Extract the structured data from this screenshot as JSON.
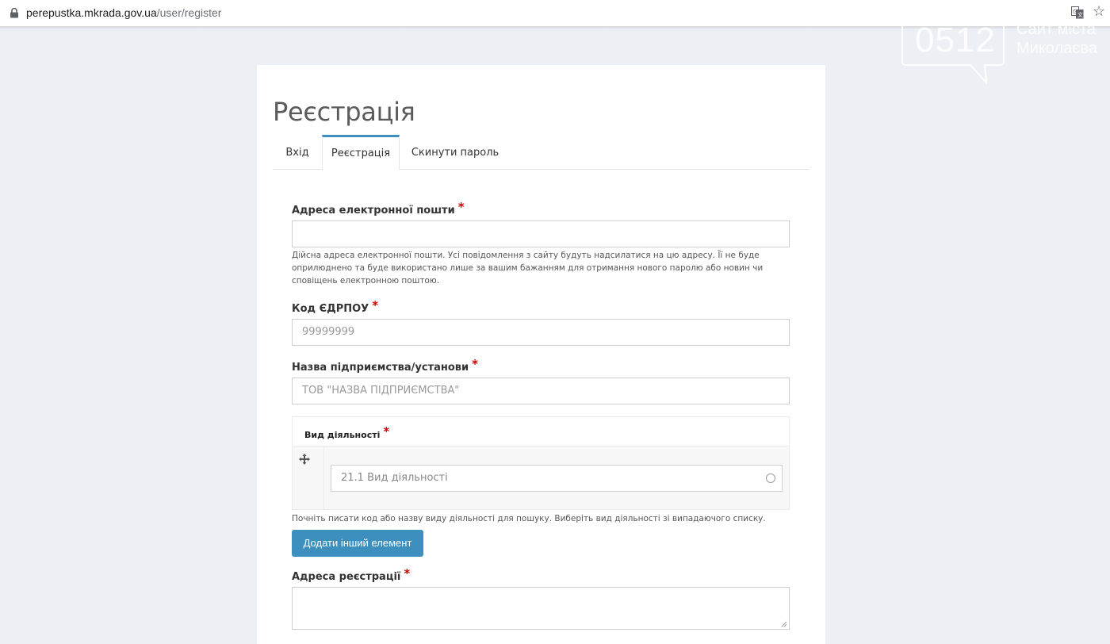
{
  "browser": {
    "url_domain": "perepustka.mkrada.gov.ua",
    "url_path": "/user/register"
  },
  "watermark": {
    "number": "0512",
    "line1": "Сайт міста",
    "line2": "Миколаєва"
  },
  "page": {
    "title": "Реєстрація",
    "tabs": [
      {
        "label": "Вхід",
        "active": false
      },
      {
        "label": "Реєстрація",
        "active": true
      },
      {
        "label": "Скинути пароль",
        "active": false
      }
    ]
  },
  "form": {
    "email": {
      "label": "Адреса електронної пошти",
      "required_mark": "*",
      "value": "",
      "description": "Дійсна адреса електронної пошти. Усі повідомлення з сайту будуть надсилатися на цю адресу. Її не буде оприлюднено та буде використано лише за вашим бажанням для отримання нового паролю або новин чи сповіщень електронною поштою."
    },
    "edrpou": {
      "label": "Код ЄДРПОУ",
      "required_mark": "*",
      "placeholder": "99999999"
    },
    "company": {
      "label": "Назва підприємства/установи",
      "required_mark": "*",
      "placeholder": "ТОВ \"НАЗВА ПІДПРИЄМСТВА\""
    },
    "activity": {
      "label": "Вид діяльності",
      "required_mark": "*",
      "placeholder": "21.1 Вид діяльності",
      "description": "Почніть писати код або назву виду діяльності для пошуку. Виберіть вид діяльності зі випадаючого списку.",
      "add_button": "Додати інший елемент"
    },
    "address": {
      "label": "Адреса реєстрації",
      "required_mark": "*",
      "value": ""
    }
  },
  "colors": {
    "accent": "#3d8fbe",
    "required": "#d20000",
    "background": "#eceff3"
  }
}
